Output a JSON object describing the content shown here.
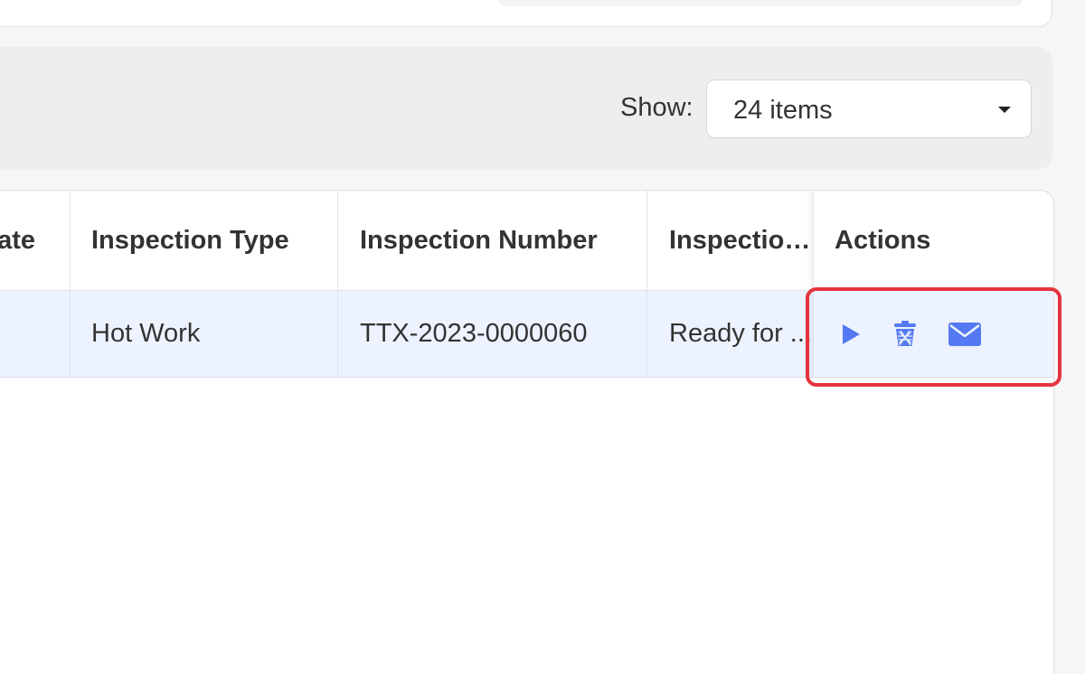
{
  "toolbar": {
    "show_label": "Show:",
    "page_size_value": "24 items"
  },
  "table": {
    "headers": {
      "date": "ate",
      "type": "Inspection Type",
      "number": "Inspection Number",
      "status": "Inspection...",
      "actions": "Actions"
    },
    "rows": [
      {
        "date": "",
        "type": "Hot Work",
        "number": "TTX-2023-0000060",
        "status": "Ready for ..."
      }
    ]
  },
  "icons": {
    "start": "play-icon",
    "delete": "trash-icon",
    "email": "mail-icon"
  },
  "colors": {
    "action_icon": "#5479f2",
    "row_highlight": "#edf3fe",
    "annotation_outline": "#e5343f",
    "toolbar_bg": "#eeeeee"
  }
}
